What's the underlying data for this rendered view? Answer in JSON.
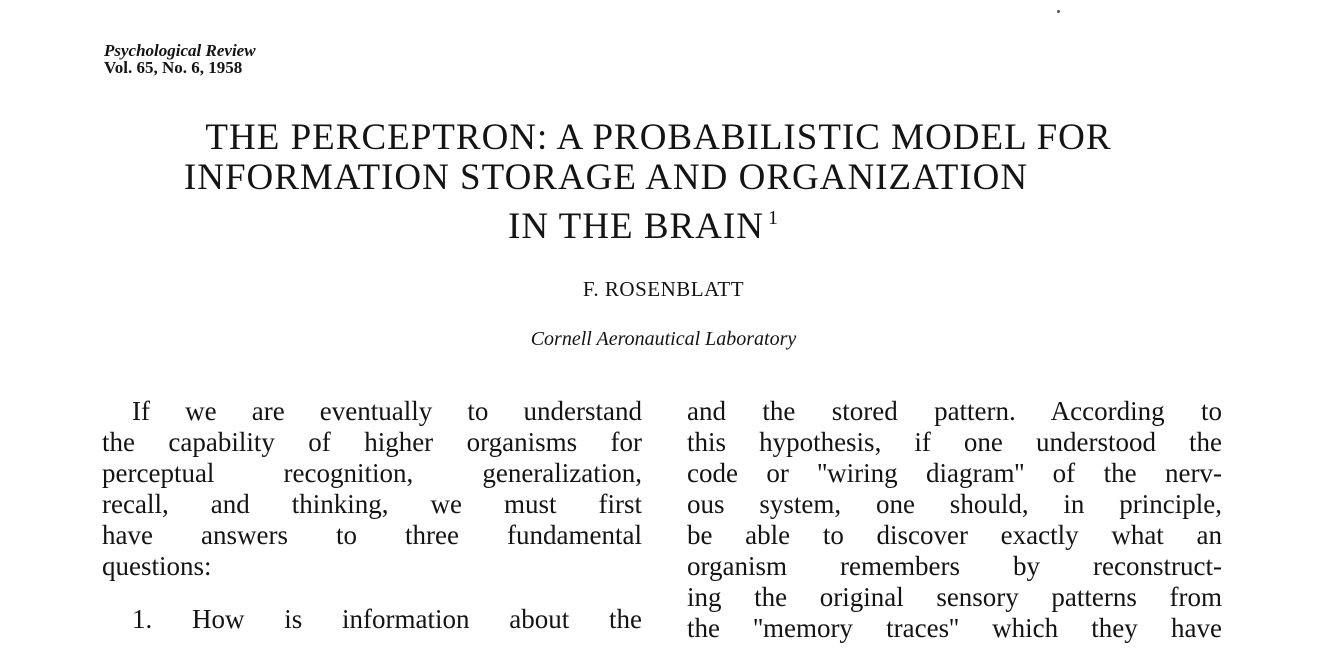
{
  "journal": {
    "name": "Psychological Review",
    "volume": "Vol. 65, No. 6, 1958"
  },
  "title": {
    "line1": "THE PERCEPTRON: A PROBABILISTIC MODEL FOR",
    "line2": "INFORMATION STORAGE AND ORGANIZATION",
    "line3": "IN THE BRAIN",
    "footnote_mark": "1"
  },
  "author": "F. ROSENBLATT",
  "affiliation": "Cornell Aeronautical Laboratory",
  "left_column": {
    "lines": [
      "If we are eventually to understand",
      "the capability of higher organisms for",
      "perceptual recognition, generalization,",
      "recall, and thinking, we must first",
      "have answers to three fundamental",
      "questions:"
    ],
    "next_line": "1. How is information about the"
  },
  "right_column": {
    "lines": [
      "and the stored pattern.  According to",
      "this hypothesis, if one understood the",
      "code or ''wiring diagram'' of the nerv-",
      "ous system, one should, in principle,",
      "be able to discover exactly what an",
      "organism remembers by reconstruct-",
      "ing the original sensory patterns from",
      "the ''memory traces'' which they have"
    ]
  }
}
